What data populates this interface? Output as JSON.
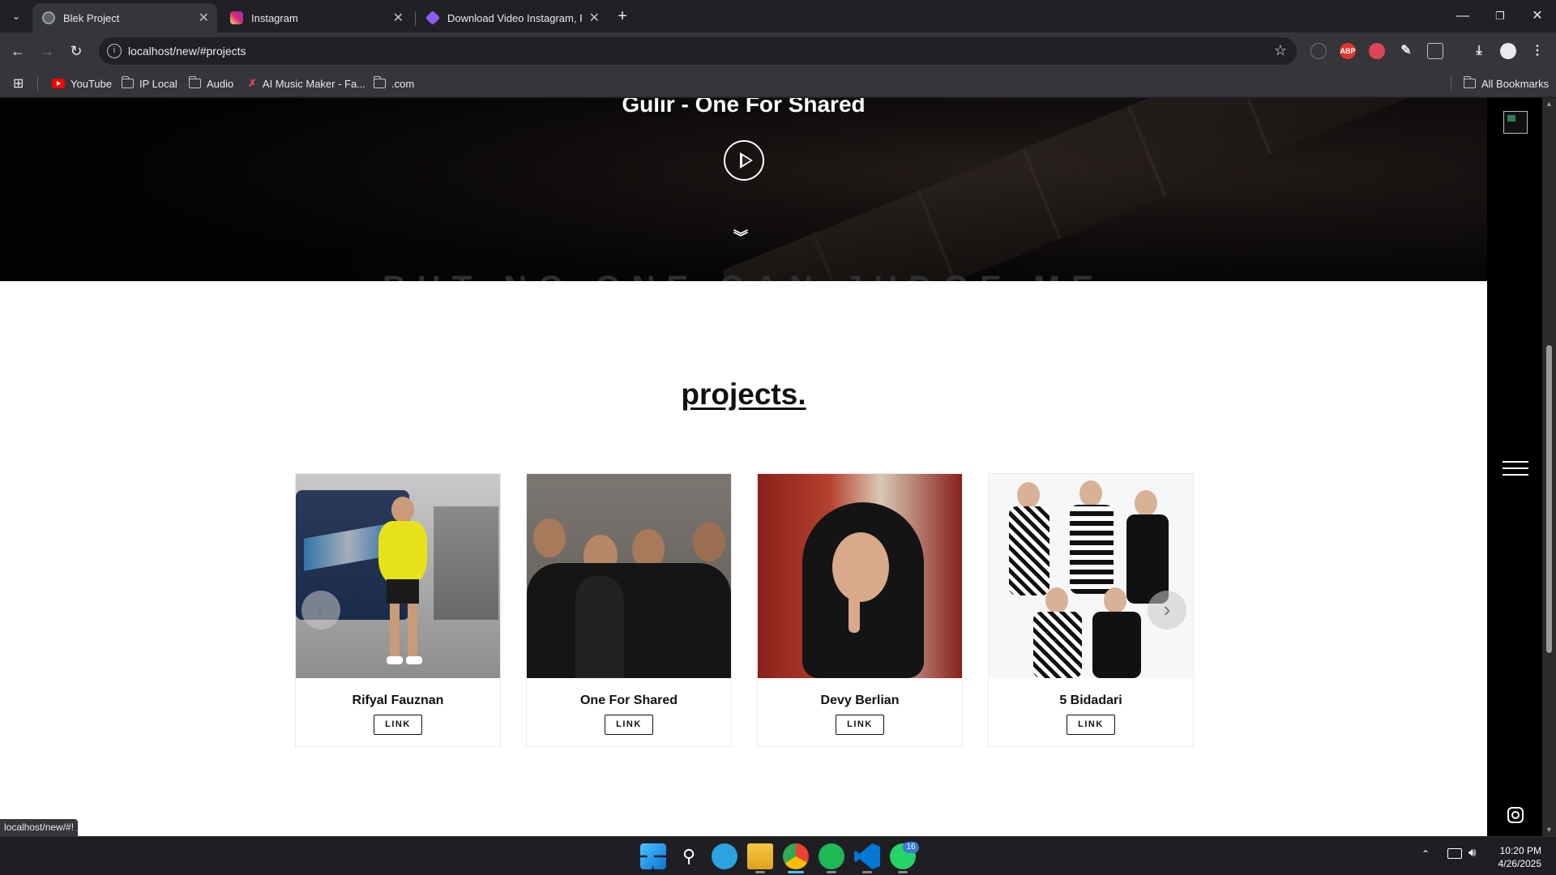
{
  "browser": {
    "tabs": [
      {
        "title": "Blek Project",
        "active": true
      },
      {
        "title": "Instagram",
        "active": false
      },
      {
        "title": "Download Video Instagram, Fot",
        "active": false
      }
    ],
    "url": "localhost/new/#projects",
    "bookmarks": [
      {
        "label": "YouTube",
        "icon": "youtube-icon"
      },
      {
        "label": "IP Local",
        "icon": "folder-icon"
      },
      {
        "label": "Audio",
        "icon": "folder-icon"
      },
      {
        "label": "AI Music Maker - Fa...",
        "icon": "ai-music-icon"
      },
      {
        "label": ".com",
        "icon": "folder-icon"
      }
    ],
    "all_bookmarks": "All Bookmarks",
    "status_url": "localhost/new/#!",
    "extension_abp_label": "ABP"
  },
  "hero": {
    "title": "Gulir - One For Shared",
    "background_text": "BUT NO ONE CAN JUDGE ME"
  },
  "projects": {
    "heading": "projects.",
    "cards": [
      {
        "name": "Rifyal Fauznan",
        "link": "LINK"
      },
      {
        "name": "One For Shared",
        "link": "LINK"
      },
      {
        "name": "Devy Berlian",
        "link": "LINK"
      },
      {
        "name": "5 Bidadari",
        "link": "LINK"
      }
    ]
  },
  "taskbar": {
    "time": "10:20 PM",
    "date": "4/26/2025",
    "whatsapp_badge": "16"
  }
}
